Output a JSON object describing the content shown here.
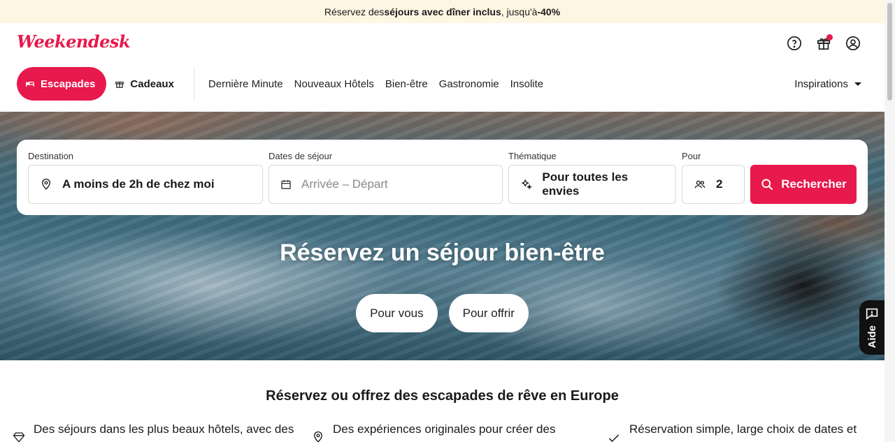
{
  "promo": {
    "prefix": "Réservez des ",
    "bold": "séjours avec dîner inclus",
    "middle": ", jusqu'à ",
    "discount": "-40%"
  },
  "brand": {
    "logo": "Weekendesk",
    "accent": "#e8194c"
  },
  "header_icons": [
    "help-circle-icon",
    "gift-icon",
    "user-circle-icon"
  ],
  "nav": {
    "escapades": "Escapades",
    "cadeaux": "Cadeaux",
    "links": [
      "Dernière Minute",
      "Nouveaux Hôtels",
      "Bien-être",
      "Gastronomie",
      "Insolite"
    ],
    "inspirations": "Inspirations"
  },
  "search": {
    "destination_label": "Destination",
    "destination_value": "A moins de 2h de chez moi",
    "dates_label": "Dates de séjour",
    "dates_placeholder": "Arrivée – Départ",
    "theme_label": "Thématique",
    "theme_value": "Pour toutes les envies",
    "guests_label": "Pour",
    "guests_value": "2",
    "button": "Rechercher"
  },
  "hero": {
    "title": "Réservez un séjour bien-être",
    "btn_you": "Pour vous",
    "btn_gift": "Pour offrir"
  },
  "help": {
    "label": "Aide"
  },
  "section": {
    "title": "Réservez ou offrez des escapades de rêve en Europe",
    "features": [
      "Des séjours dans les plus beaux hôtels, avec des",
      "Des expériences originales pour créer des",
      "Réservation simple, large choix de dates et"
    ]
  }
}
